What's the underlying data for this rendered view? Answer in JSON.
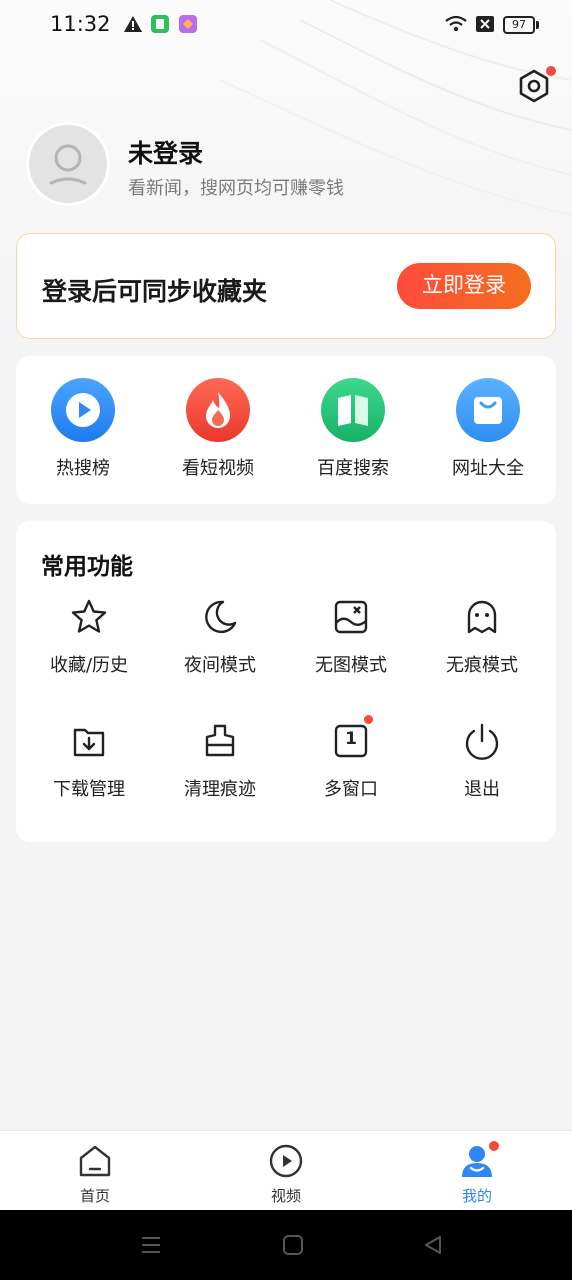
{
  "status_bar": {
    "time": "11:32",
    "battery": "97"
  },
  "profile": {
    "name": "未登录",
    "subtitle": "看新闻，搜网页均可赚零钱"
  },
  "login_card": {
    "text": "登录后可同步收藏夹",
    "button_label": "立即登录"
  },
  "quick_links": [
    {
      "label": "热搜榜",
      "icon": "play-icon",
      "color": "#2f8af5"
    },
    {
      "label": "看短视频",
      "icon": "flame-icon",
      "color": "#f04a3a"
    },
    {
      "label": "百度搜索",
      "icon": "book-icon",
      "color": "#23c47a"
    },
    {
      "label": "网址大全",
      "icon": "shopping-bag-icon",
      "color": "#3d9cf6"
    }
  ],
  "common_functions": {
    "title": "常用功能",
    "items": [
      {
        "label": "收藏/历史",
        "icon": "star-icon"
      },
      {
        "label": "夜间模式",
        "icon": "moon-icon"
      },
      {
        "label": "无图模式",
        "icon": "no-image-icon"
      },
      {
        "label": "无痕模式",
        "icon": "ghost-icon"
      },
      {
        "label": "下载管理",
        "icon": "download-folder-icon"
      },
      {
        "label": "清理痕迹",
        "icon": "clean-brush-icon"
      },
      {
        "label": "多窗口",
        "icon": "multi-window-icon",
        "badge": "1"
      },
      {
        "label": "退出",
        "icon": "power-icon"
      }
    ]
  },
  "bottom_nav": [
    {
      "label": "首页",
      "icon": "home-icon",
      "active": false
    },
    {
      "label": "视频",
      "icon": "video-icon",
      "active": false
    },
    {
      "label": "我的",
      "icon": "user-icon",
      "active": true
    }
  ],
  "colors": {
    "accent": "#2f86f6",
    "login_gradient_start": "#ff4a3d",
    "login_gradient_end": "#f46f1f",
    "badge": "#f24b3b"
  }
}
